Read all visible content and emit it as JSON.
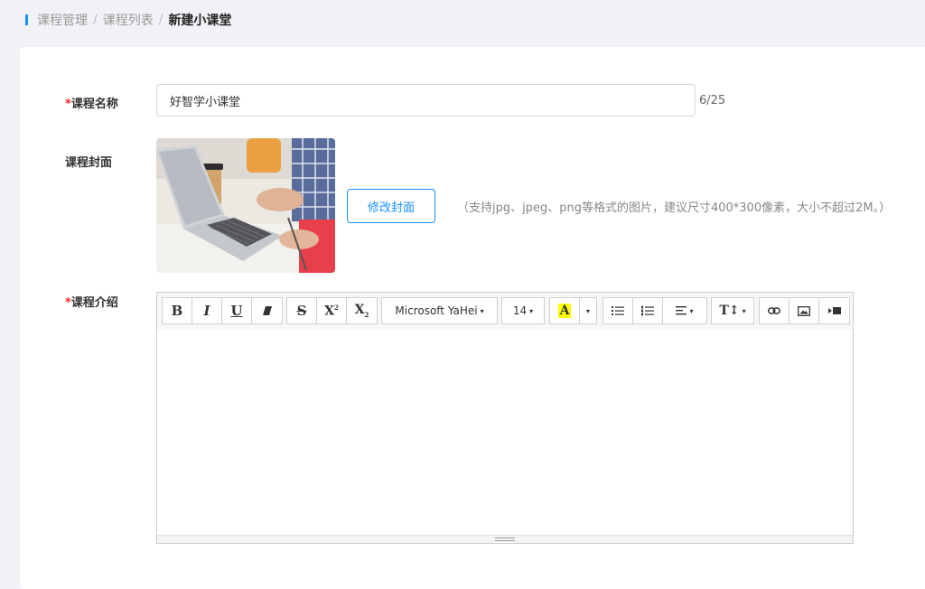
{
  "breadcrumb": {
    "items": [
      "课程管理",
      "课程列表"
    ],
    "separator": "/",
    "current": "新建小课堂"
  },
  "form": {
    "required_mark": "*",
    "name_label": "课程名称",
    "name_value": "好智学小课堂",
    "name_counter": "6/25",
    "cover_label": "课程封面",
    "change_cover_button": "修改封面",
    "cover_hint": "（支持jpg、jpeg、png等格式的图片，建议尺寸400*300像素，大小不超过2M。）",
    "intro_label": "课程介绍"
  },
  "editor": {
    "toolbar": {
      "bold": "B",
      "italic": "I",
      "underline": "U",
      "strikethrough": "S",
      "superscript": "X",
      "subscript": "X",
      "font_family": "Microsoft YaHei",
      "font_size": "14",
      "font_color": "A",
      "line_height": "T",
      "caret": "▾"
    },
    "icons": [
      "bold-icon",
      "italic-icon",
      "underline-icon",
      "clear-format-icon",
      "strikethrough-icon",
      "superscript-icon",
      "subscript-icon",
      "font-color-icon",
      "unordered-list-icon",
      "ordered-list-icon",
      "align-icon",
      "line-height-icon",
      "link-icon",
      "image-icon",
      "video-icon"
    ],
    "content": ""
  },
  "colors": {
    "accent": "#1890ff",
    "required": "#f5222d",
    "highlight": "#ffff00"
  }
}
